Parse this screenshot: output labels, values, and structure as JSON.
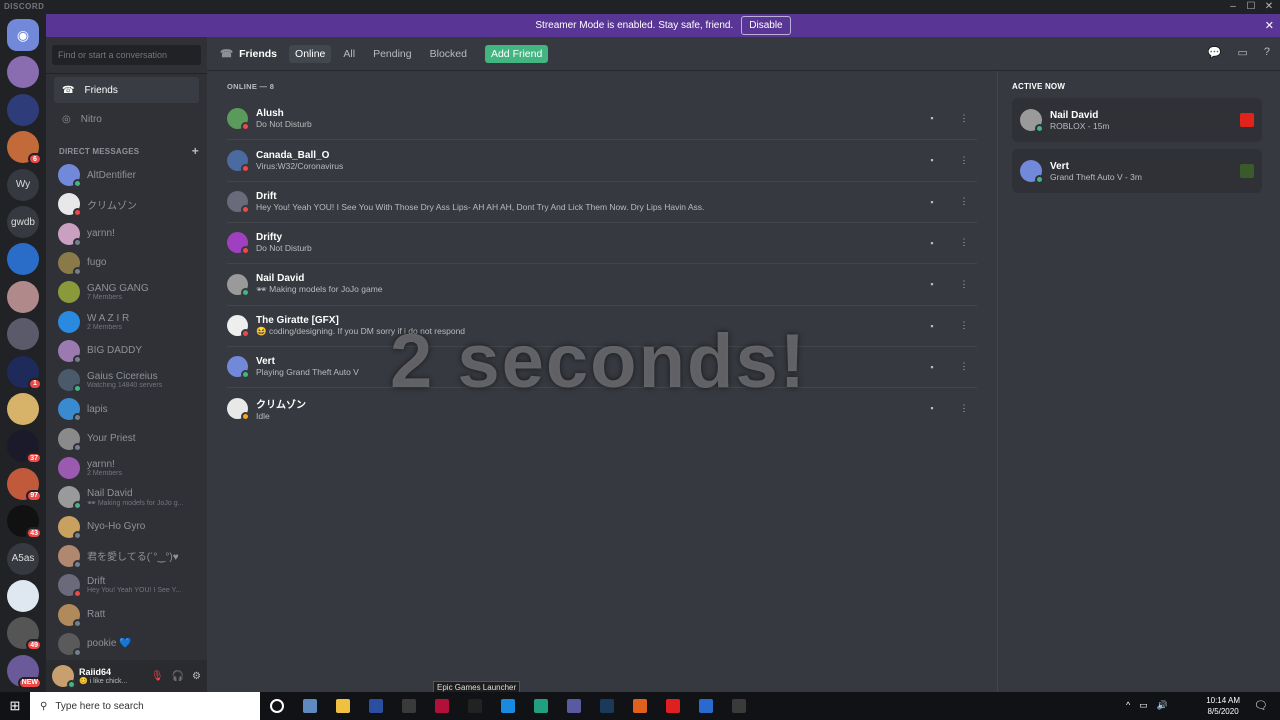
{
  "window": {
    "brand": "DISCORD"
  },
  "banner": {
    "text": "Streamer Mode is enabled. Stay safe, friend.",
    "button": "Disable"
  },
  "guilds": [
    {
      "label": "",
      "badge": "",
      "color": "#7289da"
    },
    {
      "label": "",
      "badge": "",
      "color": "#8a6db0"
    },
    {
      "label": "",
      "badge": "",
      "color": "#2e3d7a"
    },
    {
      "label": "",
      "badge": "6",
      "color": "#c26a3a"
    },
    {
      "label": "Wy",
      "badge": "",
      "color": "#36393f"
    },
    {
      "label": "gwdb",
      "badge": "",
      "color": "#36393f"
    },
    {
      "label": "",
      "badge": "",
      "color": "#2a6dc9"
    },
    {
      "label": "",
      "badge": "",
      "color": "#b08a8a"
    },
    {
      "label": "",
      "badge": "",
      "color": "#5a5a6a"
    },
    {
      "label": "",
      "badge": "1",
      "color": "#1e2a5a"
    },
    {
      "label": "",
      "badge": "",
      "color": "#d7b36a"
    },
    {
      "label": "",
      "badge": "37",
      "color": "#1a1a2a"
    },
    {
      "label": "",
      "badge": "97",
      "color": "#c05a3a"
    },
    {
      "label": "",
      "badge": "43",
      "color": "#111111"
    },
    {
      "label": "A5as",
      "badge": "",
      "color": "#36393f"
    },
    {
      "label": "",
      "badge": "",
      "color": "#dfe8f0"
    },
    {
      "label": "",
      "badge": "49",
      "color": "#555555"
    },
    {
      "label": "",
      "badge": "NEW",
      "color": "#6a5a9a"
    }
  ],
  "sidebar": {
    "search_placeholder": "Find or start a conversation",
    "nav": [
      {
        "label": "Friends",
        "icon": "wave-icon"
      },
      {
        "label": "Nitro",
        "icon": "nitro-icon"
      }
    ],
    "dm_header": "DIRECT MESSAGES",
    "dms": [
      {
        "name": "AltDentifier",
        "sub": "",
        "status": "online",
        "color": "#7289da"
      },
      {
        "name": "クリムゾン",
        "sub": "",
        "status": "dnd",
        "color": "#e8e8e8"
      },
      {
        "name": "yarnn!",
        "sub": "",
        "status": "off",
        "color": "#c9a0c0"
      },
      {
        "name": "fugo",
        "sub": "",
        "status": "off",
        "color": "#8a7a4a"
      },
      {
        "name": "GANG GANG",
        "sub": "7 Members",
        "status": "",
        "color": "#8a9a3a"
      },
      {
        "name": "W A Z I R",
        "sub": "2 Members",
        "status": "",
        "color": "#2a8ae0"
      },
      {
        "name": "BIG DADDY",
        "sub": "",
        "status": "off",
        "color": "#9a7ab0"
      },
      {
        "name": "Gaius Cicereius",
        "sub": "Watching 14840 servers",
        "status": "online",
        "color": "#4a5a6a"
      },
      {
        "name": "lapis",
        "sub": "",
        "status": "off",
        "color": "#3a8ad0"
      },
      {
        "name": "Your Priest",
        "sub": "",
        "status": "off",
        "color": "#8a8a8a"
      },
      {
        "name": "yarnn!",
        "sub": "2 Members",
        "status": "",
        "color": "#9a5ab0"
      },
      {
        "name": "Nail David",
        "sub": "🕶 Making models for JoJo g...",
        "status": "online",
        "color": "#9a9a9a"
      },
      {
        "name": "Nyo-Ho Gyro",
        "sub": "",
        "status": "off",
        "color": "#c8a060"
      },
      {
        "name": "君を愛してる(´°‿°)♥",
        "sub": "",
        "status": "off",
        "color": "#b08870"
      },
      {
        "name": "Drift",
        "sub": "Hey You! Yeah YOU! I See Y...",
        "status": "dnd",
        "color": "#6a6a7a"
      },
      {
        "name": "Ratt",
        "sub": "",
        "status": "off",
        "color": "#b08a5a"
      },
      {
        "name": "pookie 💙",
        "sub": "",
        "status": "off",
        "color": "#5a5a5a"
      }
    ]
  },
  "user": {
    "name": "Raiid64",
    "sub": "😊 i like chick...",
    "color": "#c8a070"
  },
  "topbar": {
    "title": "Friends",
    "tabs": [
      "Online",
      "All",
      "Pending",
      "Blocked"
    ],
    "add_friend": "Add Friend"
  },
  "friends": {
    "header": "ONLINE — 8",
    "rows": [
      {
        "name": "Alush",
        "sub": "Do Not Disturb",
        "status": "dnd",
        "color": "#5a9a5a"
      },
      {
        "name": "Canada_Ball_O",
        "sub": "Virus:W32/Coronavirus",
        "status": "dnd",
        "color": "#4a6aa0"
      },
      {
        "name": "Drift",
        "sub": "Hey You! Yeah YOU! I See You With Those Dry Ass Lips- AH AH AH, Dont Try And Lick Them Now. Dry Lips Havin Ass.",
        "status": "dnd",
        "color": "#6a6a7a"
      },
      {
        "name": "Drifty",
        "sub": "Do Not Disturb",
        "status": "dnd",
        "color": "#a040c0"
      },
      {
        "name": "Nail David",
        "sub": "🕶 Making models for JoJo game",
        "status": "online",
        "color": "#9a9a9a"
      },
      {
        "name": "The Giratte [GFX]",
        "sub": "😆 coding/designing. If you DM sorry if i do not respond",
        "status": "dnd",
        "color": "#eeeeee"
      },
      {
        "name": "Vert",
        "sub": "Playing Grand Theft Auto V",
        "status": "online",
        "color": "#7289da"
      },
      {
        "name": "クリムゾン",
        "sub": "Idle",
        "status": "idle",
        "color": "#e8e8e8"
      }
    ]
  },
  "active_now": {
    "header": "ACTIVE NOW",
    "cards": [
      {
        "name": "Nail David",
        "sub": "ROBLOX - 15m",
        "status": "online",
        "color": "#9a9a9a",
        "game_color": "#e2231a"
      },
      {
        "name": "Vert",
        "sub": "Grand Theft Auto V - 3m",
        "status": "online",
        "color": "#7289da",
        "game_color": "#3a5a2a"
      }
    ]
  },
  "overlay": "2 seconds!",
  "tooltip": "Epic Games Launcher",
  "taskbar": {
    "search": "Type here to search",
    "time": "10:14 AM",
    "date": "8/5/2020",
    "apps": [
      "#ffffff",
      "#5f8ac0",
      "#f0c040",
      "#2a4fa0",
      "#3a3a3a",
      "#b0103a",
      "#222222",
      "#1a8ae0",
      "#20a080",
      "#5a5aa0",
      "#1a3a5a",
      "#e06020",
      "#e02020",
      "#2a6ad0",
      "#3a3a3a"
    ]
  }
}
